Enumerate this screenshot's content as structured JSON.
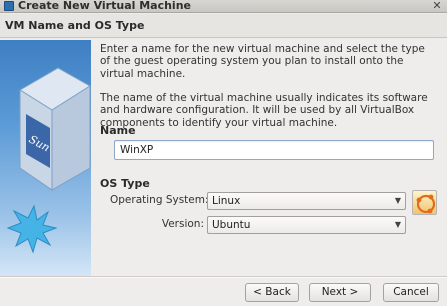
{
  "window": {
    "title": "Create New Virtual Machine",
    "close_glyph": "✕"
  },
  "header": {
    "title": "VM Name and OS Type"
  },
  "side_image": {
    "logo_text": "Sun"
  },
  "main": {
    "intro_text": "Enter a name for the new virtual machine and select the type of the guest operating system you plan to install onto the virtual machine.",
    "info_text": "The name of the virtual machine usually indicates its software and hardware configuration. It will be used by all VirtualBox components to identify your virtual machine.",
    "name_section_label": "Name",
    "name_value": "WinXP",
    "os_section_label": "OS Type",
    "os_system_label": "Operating System:",
    "os_system_value": "Linux",
    "version_label": "Version:",
    "version_value": "Ubuntu",
    "os_icon": "ubuntu-logo-icon"
  },
  "footer": {
    "back_label": "< Back",
    "next_label": "Next >",
    "cancel_label": "Cancel"
  },
  "colors": {
    "dialog_bg": "#eeedeb",
    "image_blue": "#3e7fc3",
    "starburst": "#45b3e6"
  }
}
